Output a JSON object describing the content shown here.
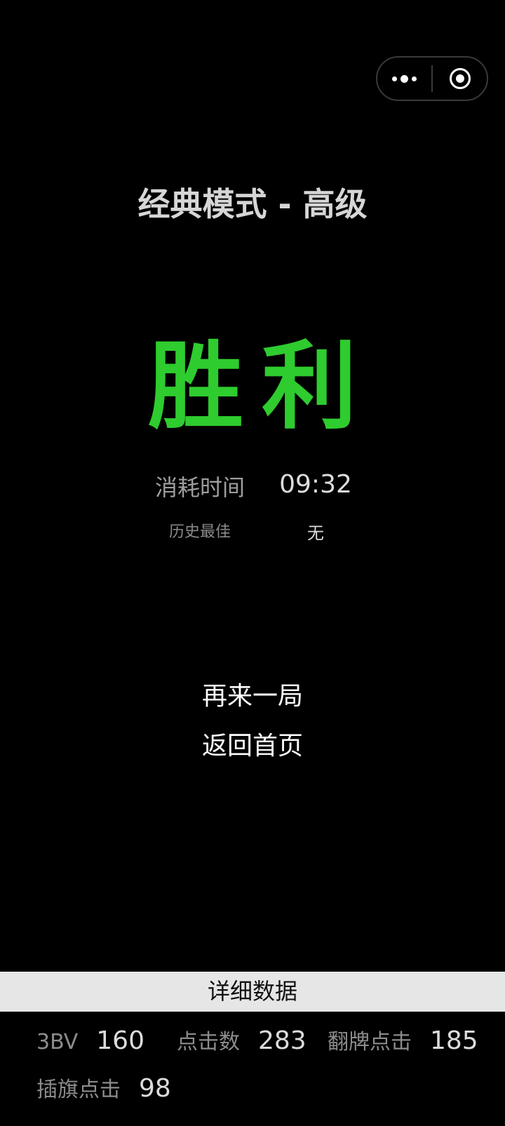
{
  "capsule": {
    "menu_icon": "more-dots-icon",
    "close_icon": "target-circle-icon"
  },
  "header": {
    "mode_title": "经典模式 - 高级"
  },
  "result": {
    "text": "胜利",
    "color": "#2ecc2e"
  },
  "stats": {
    "time_label": "消耗时间",
    "time_value": "09:32",
    "best_label": "历史最佳",
    "best_value": "无"
  },
  "actions": {
    "play_again": "再来一局",
    "back_home": "返回首页"
  },
  "details": {
    "title": "详细数据",
    "items": [
      {
        "label": "3BV",
        "value": "160"
      },
      {
        "label": "点击数",
        "value": "283"
      },
      {
        "label": "翻牌点击",
        "value": "185"
      },
      {
        "label": "插旗点击",
        "value": "98"
      }
    ]
  }
}
